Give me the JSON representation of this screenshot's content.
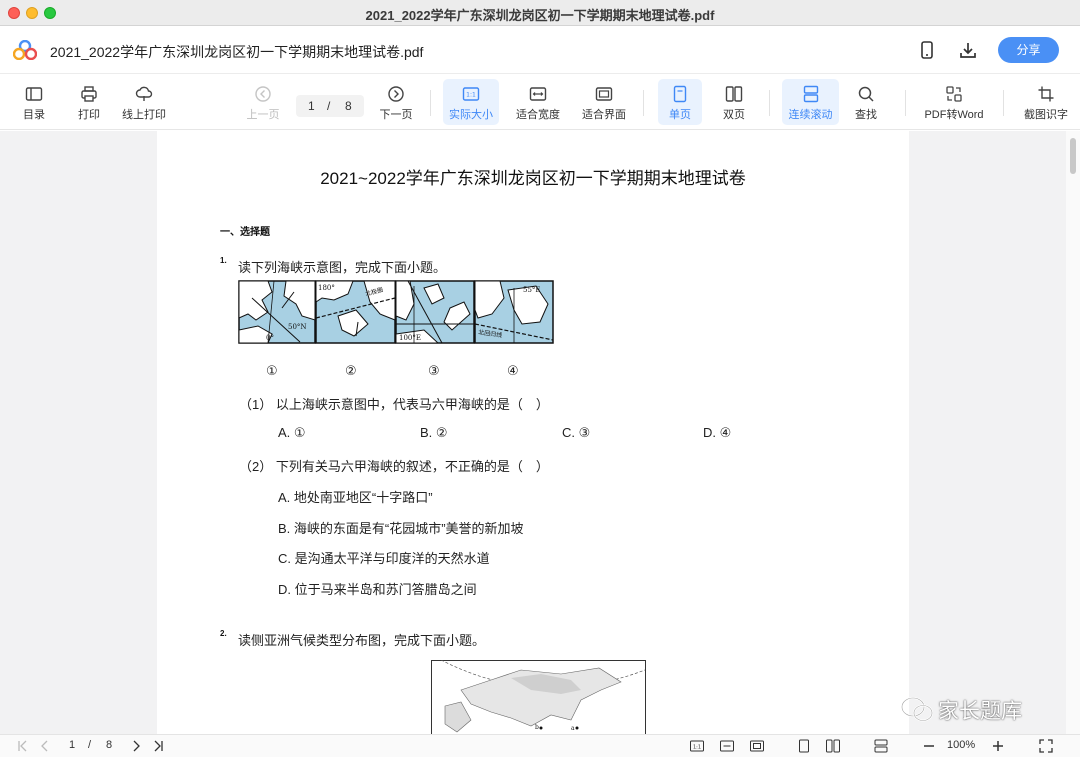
{
  "window": {
    "title": "2021_2022学年广东深圳龙岗区初一下学期期末地理试卷.pdf"
  },
  "header": {
    "doc_title": "2021_2022学年广东深圳龙岗区初一下学期期末地理试卷.pdf",
    "share_label": "分享"
  },
  "toolbar": {
    "toc": "目录",
    "print": "打印",
    "online_print": "线上打印",
    "prev": "上一页",
    "page_current": "1",
    "page_sep": "/",
    "page_total": "8",
    "next": "下一页",
    "actual_size": "实际大小",
    "fit_width": "适合宽度",
    "fit_page": "适合界面",
    "single": "单页",
    "double": "双页",
    "continuous": "连续滚动",
    "find": "查找",
    "pdf_to_word": "PDF转Word",
    "ocr": "截图识字"
  },
  "document": {
    "title": "2021~2022学年广东深圳龙岗区初一下学期期末地理试卷",
    "section": "一、选择题",
    "q1": {
      "num": "1.",
      "stem": "读下列海峡示意图，完成下面小题。",
      "map_labels": [
        "①",
        "②",
        "③",
        "④"
      ],
      "sub1": "（1） 以上海峡示意图中，代表马六甲海峡的是（　）",
      "sub1_options": [
        "A. ①",
        "B. ②",
        "C. ③",
        "D. ④"
      ],
      "sub2": "（2） 下列有关马六甲海峡的叙述，不正确的是（　）",
      "sub2_options": [
        "A. 地处南亚地区“十字路口”",
        "B. 海峡的东面是有“花园城市”美誉的新加坡",
        "C. 是沟通太平洋与印度洋的天然水道",
        "D. 位于马来半岛和苏门答腊岛之间"
      ]
    },
    "q2": {
      "num": "2.",
      "stem": "读侧亚洲气候类型分布图，完成下面小题。"
    }
  },
  "statusbar": {
    "page_current": "1",
    "page_sep": "/",
    "page_total": "8",
    "zoom": "100%"
  },
  "watermark": {
    "text": "家长题库"
  },
  "colors": {
    "accent": "#4a90f5",
    "active_bg": "#e9f2fe",
    "sea": "#a8d0e3"
  }
}
